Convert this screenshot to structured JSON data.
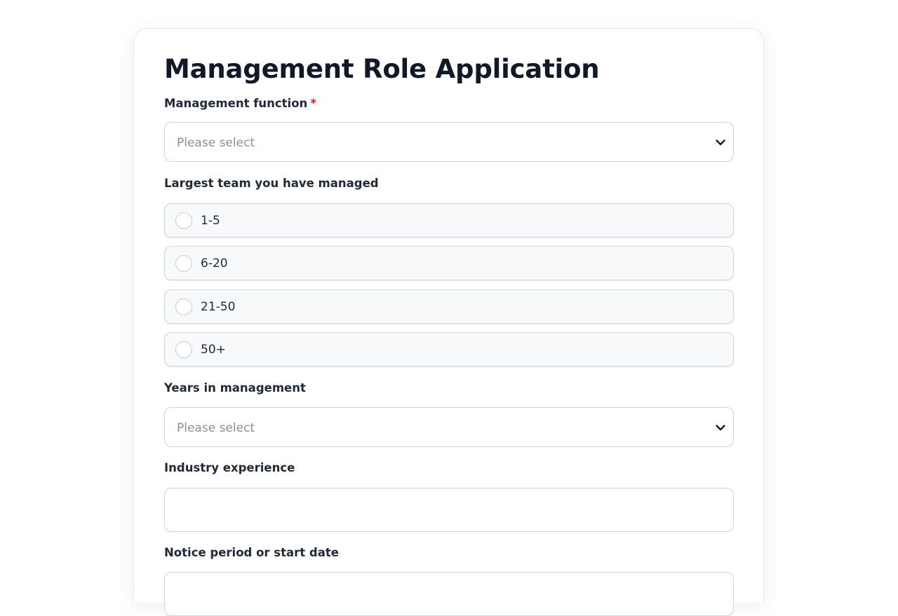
{
  "form": {
    "title": "Management Role Application",
    "fields": {
      "management_function": {
        "label": "Management function",
        "required_marker": "*",
        "placeholder": "Please select"
      },
      "largest_team": {
        "label": "Largest team you have managed",
        "options": [
          "1-5",
          "6-20",
          "21-50",
          "50+"
        ]
      },
      "years_in_management": {
        "label": "Years in management",
        "placeholder": "Please select"
      },
      "industry_experience": {
        "label": "Industry experience",
        "value": ""
      },
      "notice_period": {
        "label": "Notice period or start date",
        "value": ""
      }
    }
  },
  "icons": {
    "select_chevron": "chevron-down-icon"
  }
}
